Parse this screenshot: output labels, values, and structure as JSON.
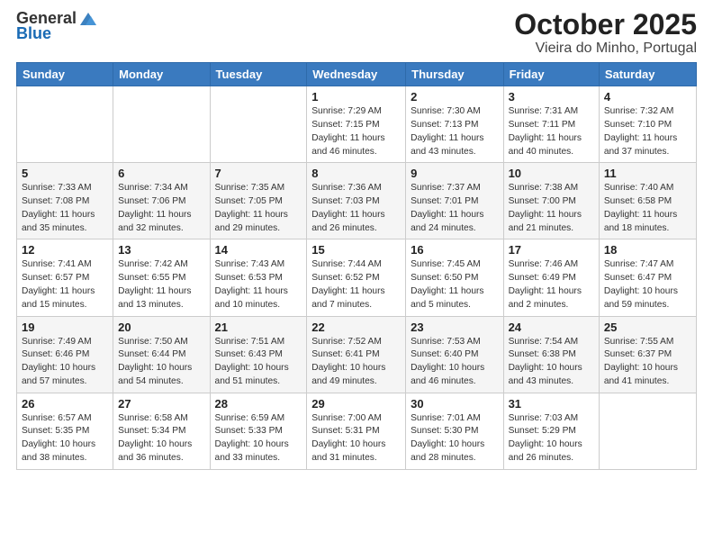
{
  "logo": {
    "general": "General",
    "blue": "Blue"
  },
  "title": "October 2025",
  "subtitle": "Vieira do Minho, Portugal",
  "days_of_week": [
    "Sunday",
    "Monday",
    "Tuesday",
    "Wednesday",
    "Thursday",
    "Friday",
    "Saturday"
  ],
  "weeks": [
    [
      {
        "day": "",
        "info": ""
      },
      {
        "day": "",
        "info": ""
      },
      {
        "day": "",
        "info": ""
      },
      {
        "day": "1",
        "info": "Sunrise: 7:29 AM\nSunset: 7:15 PM\nDaylight: 11 hours\nand 46 minutes."
      },
      {
        "day": "2",
        "info": "Sunrise: 7:30 AM\nSunset: 7:13 PM\nDaylight: 11 hours\nand 43 minutes."
      },
      {
        "day": "3",
        "info": "Sunrise: 7:31 AM\nSunset: 7:11 PM\nDaylight: 11 hours\nand 40 minutes."
      },
      {
        "day": "4",
        "info": "Sunrise: 7:32 AM\nSunset: 7:10 PM\nDaylight: 11 hours\nand 37 minutes."
      }
    ],
    [
      {
        "day": "5",
        "info": "Sunrise: 7:33 AM\nSunset: 7:08 PM\nDaylight: 11 hours\nand 35 minutes."
      },
      {
        "day": "6",
        "info": "Sunrise: 7:34 AM\nSunset: 7:06 PM\nDaylight: 11 hours\nand 32 minutes."
      },
      {
        "day": "7",
        "info": "Sunrise: 7:35 AM\nSunset: 7:05 PM\nDaylight: 11 hours\nand 29 minutes."
      },
      {
        "day": "8",
        "info": "Sunrise: 7:36 AM\nSunset: 7:03 PM\nDaylight: 11 hours\nand 26 minutes."
      },
      {
        "day": "9",
        "info": "Sunrise: 7:37 AM\nSunset: 7:01 PM\nDaylight: 11 hours\nand 24 minutes."
      },
      {
        "day": "10",
        "info": "Sunrise: 7:38 AM\nSunset: 7:00 PM\nDaylight: 11 hours\nand 21 minutes."
      },
      {
        "day": "11",
        "info": "Sunrise: 7:40 AM\nSunset: 6:58 PM\nDaylight: 11 hours\nand 18 minutes."
      }
    ],
    [
      {
        "day": "12",
        "info": "Sunrise: 7:41 AM\nSunset: 6:57 PM\nDaylight: 11 hours\nand 15 minutes."
      },
      {
        "day": "13",
        "info": "Sunrise: 7:42 AM\nSunset: 6:55 PM\nDaylight: 11 hours\nand 13 minutes."
      },
      {
        "day": "14",
        "info": "Sunrise: 7:43 AM\nSunset: 6:53 PM\nDaylight: 11 hours\nand 10 minutes."
      },
      {
        "day": "15",
        "info": "Sunrise: 7:44 AM\nSunset: 6:52 PM\nDaylight: 11 hours\nand 7 minutes."
      },
      {
        "day": "16",
        "info": "Sunrise: 7:45 AM\nSunset: 6:50 PM\nDaylight: 11 hours\nand 5 minutes."
      },
      {
        "day": "17",
        "info": "Sunrise: 7:46 AM\nSunset: 6:49 PM\nDaylight: 11 hours\nand 2 minutes."
      },
      {
        "day": "18",
        "info": "Sunrise: 7:47 AM\nSunset: 6:47 PM\nDaylight: 10 hours\nand 59 minutes."
      }
    ],
    [
      {
        "day": "19",
        "info": "Sunrise: 7:49 AM\nSunset: 6:46 PM\nDaylight: 10 hours\nand 57 minutes."
      },
      {
        "day": "20",
        "info": "Sunrise: 7:50 AM\nSunset: 6:44 PM\nDaylight: 10 hours\nand 54 minutes."
      },
      {
        "day": "21",
        "info": "Sunrise: 7:51 AM\nSunset: 6:43 PM\nDaylight: 10 hours\nand 51 minutes."
      },
      {
        "day": "22",
        "info": "Sunrise: 7:52 AM\nSunset: 6:41 PM\nDaylight: 10 hours\nand 49 minutes."
      },
      {
        "day": "23",
        "info": "Sunrise: 7:53 AM\nSunset: 6:40 PM\nDaylight: 10 hours\nand 46 minutes."
      },
      {
        "day": "24",
        "info": "Sunrise: 7:54 AM\nSunset: 6:38 PM\nDaylight: 10 hours\nand 43 minutes."
      },
      {
        "day": "25",
        "info": "Sunrise: 7:55 AM\nSunset: 6:37 PM\nDaylight: 10 hours\nand 41 minutes."
      }
    ],
    [
      {
        "day": "26",
        "info": "Sunrise: 6:57 AM\nSunset: 5:35 PM\nDaylight: 10 hours\nand 38 minutes."
      },
      {
        "day": "27",
        "info": "Sunrise: 6:58 AM\nSunset: 5:34 PM\nDaylight: 10 hours\nand 36 minutes."
      },
      {
        "day": "28",
        "info": "Sunrise: 6:59 AM\nSunset: 5:33 PM\nDaylight: 10 hours\nand 33 minutes."
      },
      {
        "day": "29",
        "info": "Sunrise: 7:00 AM\nSunset: 5:31 PM\nDaylight: 10 hours\nand 31 minutes."
      },
      {
        "day": "30",
        "info": "Sunrise: 7:01 AM\nSunset: 5:30 PM\nDaylight: 10 hours\nand 28 minutes."
      },
      {
        "day": "31",
        "info": "Sunrise: 7:03 AM\nSunset: 5:29 PM\nDaylight: 10 hours\nand 26 minutes."
      },
      {
        "day": "",
        "info": ""
      }
    ]
  ]
}
